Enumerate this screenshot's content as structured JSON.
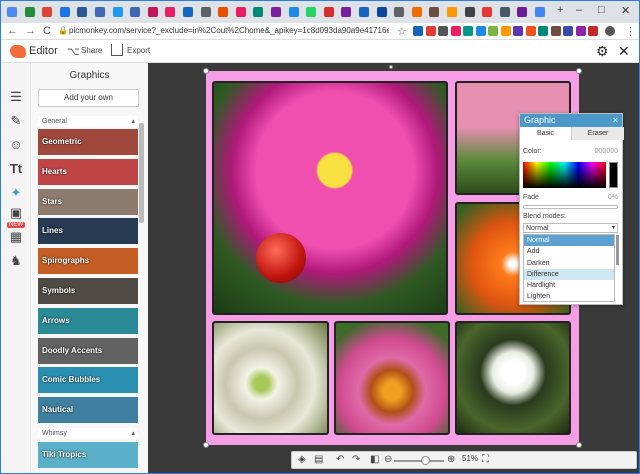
{
  "browser": {
    "url": "picmonkey.com/service?_exclude=in%2Cout%2Chome&_apikey=1c8d093da90a9e41716eb02d3c7436...",
    "new_tab": "+",
    "minimize": "–",
    "maximize": "□",
    "close": "✕",
    "back": "←",
    "forward": "→",
    "reload": "C",
    "lock": "🔒",
    "star": "☆",
    "menu": "⋮",
    "tab_colors": [
      "#4a8af4",
      "#1e8e3e",
      "#db4437",
      "#1a73e8",
      "#2b5797",
      "#4267b2",
      "#1d9bf0",
      "#4267b2",
      "#c2185b",
      "#e91e63",
      "#1565c0",
      "#5f6368",
      "#e65100",
      "#e91e63",
      "#00897b",
      "#7b1fa2",
      "#1e88e5",
      "#25d366",
      "#d32f2f",
      "#7b1fa2",
      "#1565c0",
      "#0d47a1",
      "#5f6368",
      "#ef6c00",
      "#6d4c41",
      "#ff9800",
      "#424242",
      "#e53935",
      "#455a64",
      "#6a1b9a",
      "#4285f4"
    ]
  },
  "header": {
    "title": "Editor",
    "share": "Share",
    "export": "Export",
    "share_icon": "share-icon",
    "export_icon": "export-icon",
    "settings_icon": "gear-icon",
    "close_icon": "close-icon"
  },
  "toolbar": {
    "icons": [
      "sliders-icon",
      "magic-wand-icon",
      "face-icon",
      "text-icon",
      "butterfly-icon",
      "frame-icon",
      "texture-icon",
      "theme-icon"
    ],
    "text_glyph": "Tt",
    "new_badge": "NEW"
  },
  "panel": {
    "title": "Graphics",
    "add_own": "Add your own",
    "group_general": "General",
    "group_whimsy": "Whimsy",
    "categories": [
      {
        "label": "Geometric",
        "color": "#a0483b"
      },
      {
        "label": "Hearts",
        "color": "#c04545"
      },
      {
        "label": "Stars",
        "color": "#8d7b6d"
      },
      {
        "label": "Lines",
        "color": "#263a52"
      },
      {
        "label": "Spirographs",
        "color": "#c45e24"
      },
      {
        "label": "Symbols",
        "color": "#4f4a44"
      },
      {
        "label": "Arrows",
        "color": "#2a8a96"
      },
      {
        "label": "Doodly Accents",
        "color": "#626262"
      },
      {
        "label": "Comic Bubbles",
        "color": "#2a8fb0"
      },
      {
        "label": "Nautical",
        "color": "#3f7fa0"
      }
    ],
    "whimsy_categories": [
      {
        "label": "Tiki Tropics",
        "color": "#5ab0c8"
      }
    ]
  },
  "bottom_bar": {
    "zoom": "51%",
    "icons": [
      "layers-icon",
      "grid-icon",
      "undo-icon",
      "redo-icon",
      "compare-icon",
      "zoom-out-icon",
      "zoom-in-icon",
      "fullscreen-icon"
    ],
    "zoom_level": 0.62
  },
  "dialog": {
    "title": "Graphic",
    "tab_basic": "Basic",
    "tab_eraser": "Eraser",
    "color_label": "Color:",
    "color_value": "000000",
    "fade_label": "Fade",
    "fade_value": "0%",
    "blend_label": "Blend modes:",
    "blend_selected": "Normal",
    "blend_options": [
      "Normal",
      "Add",
      "Darken",
      "Difference",
      "Hardlight",
      "Lighten"
    ],
    "close": "×",
    "dropdown_arrow": "▾"
  },
  "colors": {
    "collage_bg": "#f59ee6",
    "canvas_bg": "#3a3a3a",
    "dialog_header": "#4c98c9",
    "accent": "#f26b3a"
  }
}
